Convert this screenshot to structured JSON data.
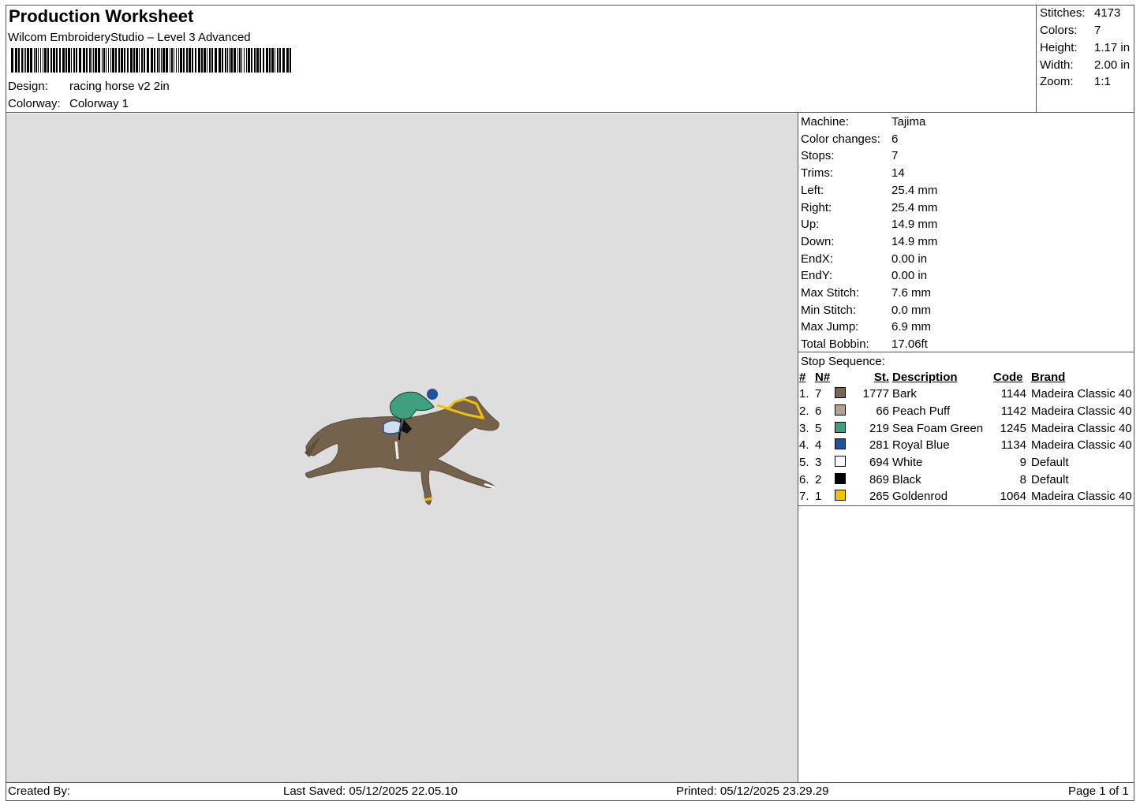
{
  "header": {
    "title": "Production Worksheet",
    "software": "Wilcom EmbroideryStudio – Level 3 Advanced",
    "design_label": "Design:",
    "design_value": "racing horse v2 2in",
    "colorway_label": "Colorway:",
    "colorway_value": "Colorway 1"
  },
  "summary": [
    {
      "label": "Stitches:",
      "value": "4173"
    },
    {
      "label": "Colors:",
      "value": "7"
    },
    {
      "label": "Height:",
      "value": "1.17 in"
    },
    {
      "label": "Width:",
      "value": "2.00 in"
    },
    {
      "label": "Zoom:",
      "value": "1:1"
    }
  ],
  "machine_stats": [
    {
      "label": "Machine:",
      "value": "Tajima"
    },
    {
      "label": "Color changes:",
      "value": "6"
    },
    {
      "label": "Stops:",
      "value": "7"
    },
    {
      "label": "Trims:",
      "value": "14"
    },
    {
      "label": "Left:",
      "value": "25.4 mm"
    },
    {
      "label": "Right:",
      "value": "25.4 mm"
    },
    {
      "label": "Up:",
      "value": "14.9 mm"
    },
    {
      "label": "Down:",
      "value": "14.9 mm"
    },
    {
      "label": "EndX:",
      "value": "0.00 in"
    },
    {
      "label": "EndY:",
      "value": "0.00 in"
    },
    {
      "label": "Max Stitch:",
      "value": "7.6 mm"
    },
    {
      "label": "Min Stitch:",
      "value": "0.0 mm"
    },
    {
      "label": "Max Jump:",
      "value": "6.9 mm"
    },
    {
      "label": "Total Bobbin:",
      "value": "17.06ft"
    }
  ],
  "stop_sequence": {
    "title": "Stop Sequence:",
    "columns": [
      "#",
      "N#",
      "St.",
      "Description",
      "Code",
      "Brand"
    ],
    "rows": [
      {
        "idx": "1.",
        "n": "7",
        "color": "#7a6553",
        "st": "1777",
        "desc": "Bark",
        "code": "1144",
        "brand": "Madeira Classic 40"
      },
      {
        "idx": "2.",
        "n": "6",
        "color": "#b8a193",
        "st": "66",
        "desc": "Peach Puff",
        "code": "1142",
        "brand": "Madeira Classic 40"
      },
      {
        "idx": "3.",
        "n": "5",
        "color": "#3f9f7f",
        "st": "219",
        "desc": "Sea Foam Green",
        "code": "1245",
        "brand": "Madeira Classic 40"
      },
      {
        "idx": "4.",
        "n": "4",
        "color": "#1f52a0",
        "st": "281",
        "desc": "Royal Blue",
        "code": "1134",
        "brand": "Madeira Classic 40"
      },
      {
        "idx": "5.",
        "n": "3",
        "color": "#ffffff",
        "st": "694",
        "desc": "White",
        "code": "9",
        "brand": "Default"
      },
      {
        "idx": "6.",
        "n": "2",
        "color": "#000000",
        "st": "869",
        "desc": "Black",
        "code": "8",
        "brand": "Default"
      },
      {
        "idx": "7.",
        "n": "1",
        "color": "#f2c200",
        "st": "265",
        "desc": "Goldenrod",
        "code": "1064",
        "brand": "Madeira Classic 40"
      }
    ]
  },
  "footer": {
    "created_by": "Created By:",
    "last_saved": "Last Saved: 05/12/2025 22.05.10",
    "printed": "Printed: 05/12/2025 23.29.29",
    "page": "Page 1 of 1"
  }
}
